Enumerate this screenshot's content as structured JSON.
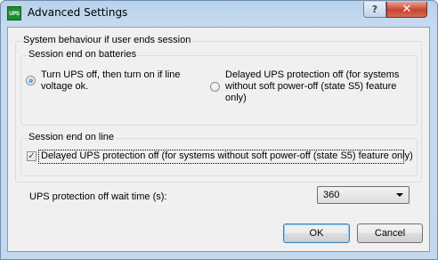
{
  "window": {
    "icon_text": "UPS",
    "title": "Advanced Settings",
    "help_glyph": "?",
    "close_glyph": "✕"
  },
  "outer_group": {
    "legend": "System behaviour if user ends session"
  },
  "batteries_group": {
    "legend": "Session end on batteries",
    "option1_line1": "Turn UPS off, then turn on if line",
    "option1_line2": "voltage ok.",
    "option1_selected": true,
    "option2_line1": "Delayed UPS protection off (for systems",
    "option2_line2": "without soft power-off (state S5) feature",
    "option2_line3": "only)",
    "option2_selected": false
  },
  "line_group": {
    "legend": "Session end on line",
    "checkbox_label": "Delayed UPS protection off (for systems without soft power-off (state S5) feature only)",
    "checkbox_checked": true,
    "check_glyph": "✓"
  },
  "wait_time": {
    "label": "UPS protection off wait time (s):",
    "value": "360"
  },
  "buttons": {
    "ok": "OK",
    "cancel": "Cancel"
  }
}
